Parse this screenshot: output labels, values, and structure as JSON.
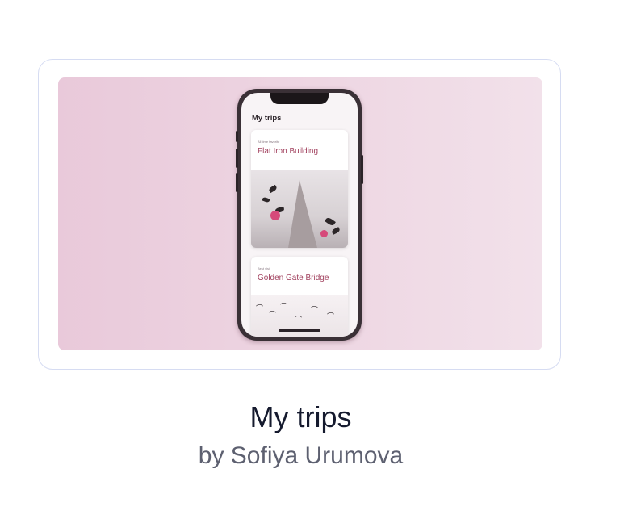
{
  "shot": {
    "phone_app": {
      "header": "My trips",
      "trips": [
        {
          "kicker": "All time favorite",
          "name": "Flat Iron Building"
        },
        {
          "kicker": "Best visit",
          "name": "Golden Gate Bridge"
        }
      ]
    }
  },
  "caption": {
    "title": "My trips",
    "author": "by Sofiya Urumova"
  },
  "colors": {
    "accent": "#a2425f",
    "preview_bg": "#edd4e1",
    "card_border": "#d6dcf2",
    "title": "#151a2e",
    "author": "#5d6070"
  }
}
